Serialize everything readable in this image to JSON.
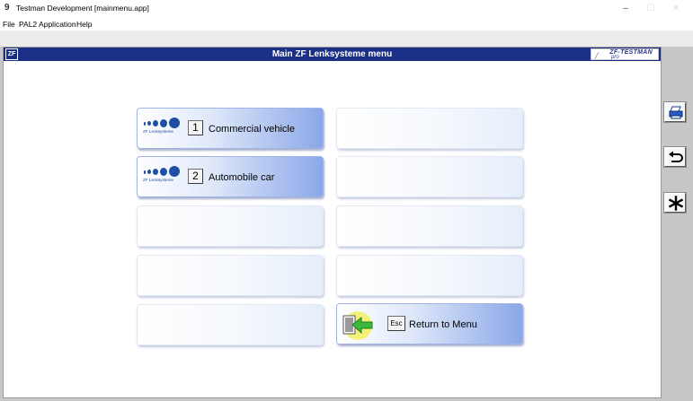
{
  "window": {
    "title": "Testman Development [mainmenu.app]",
    "minimize_glyph": "–",
    "maximize_glyph": "☐",
    "close_glyph": "✕"
  },
  "menubar": {
    "items": [
      "File",
      "PAL2 Application",
      "Help"
    ]
  },
  "header": {
    "title": "Main ZF Lenksysteme menu",
    "logo_left": "ZF",
    "brand_line1": "ZF-TESTMAN",
    "brand_line2": "pro"
  },
  "tiles": [
    {
      "key": "1",
      "label": "Commercial vehicle",
      "logo_text": "ZF Lenksysteme"
    },
    {
      "key": "2",
      "label": "Automobile car",
      "logo_text": "ZF Lenksysteme"
    }
  ],
  "return_tile": {
    "key": "Esc",
    "label": "Return to Menu"
  },
  "side_buttons": [
    "printer-icon",
    "return-arrow-icon",
    "asterisk-icon"
  ],
  "colors": {
    "header_bg": "#1c2f86",
    "tile_accent": "#8aa7e8",
    "logo_blue": "#1f4ea3",
    "highlight": "#f3f06a"
  }
}
